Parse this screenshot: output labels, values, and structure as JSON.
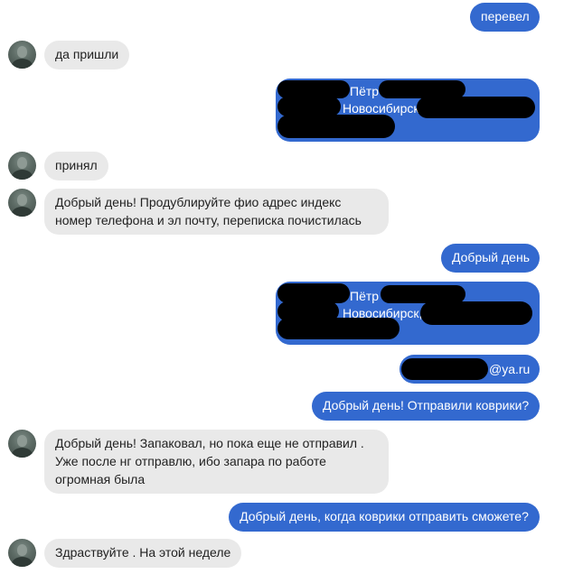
{
  "messages": {
    "m1": "перевел",
    "m2": "да пришли",
    "m3_name": "Пётр",
    "m3_city": "Новосибирск",
    "m4": "принял",
    "m5_line1": "Добрый день! Продублируйте фио адрес индекс",
    "m5_line2": "номер телефона и эл почту, переписка почистилась",
    "m6": "Добрый день",
    "m7_name": "Пётр",
    "m7_city": "Новосибирск,",
    "m8_email_suffix": "@ya.ru",
    "m9": "Добрый день! Отправили коврики?",
    "m10_line1": "Добрый день! Запаковал, но пока еще не отправил .",
    "m10_line2": "Уже после нг отправлю, ибо запара по работе",
    "m10_line3": "огромная была",
    "m11": "Добрый день, когда коврики отправить сможете?",
    "m12": "Здраствуйте . На этой неделе"
  },
  "colors": {
    "outgoing": "#3369cf",
    "incoming": "#e9e9e9",
    "redaction": "#000000"
  },
  "icons": {
    "avatar": "user-avatar-photo"
  }
}
